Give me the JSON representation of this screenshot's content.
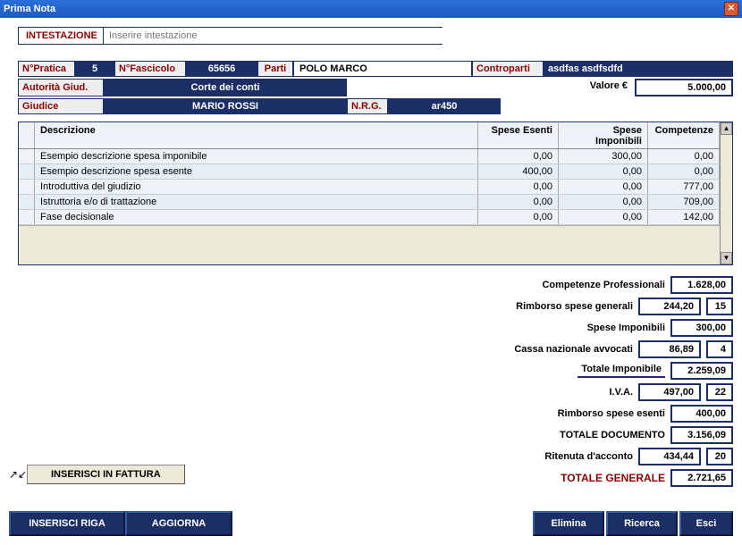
{
  "window": {
    "title": "Prima Nota"
  },
  "intestazione": {
    "label": "INTESTAZIONE",
    "placeholder": "Inserire intestazione"
  },
  "row1": {
    "npratica_label": "N°Pratica",
    "npratica_value": "5",
    "nfascicolo_label": "N°Fascicolo",
    "nfascicolo_value": "65656",
    "parti_label": "Parti",
    "parti_value": "POLO MARCO",
    "controparti_label": "Controparti",
    "controparti_value": "asdfas asdfsdfd"
  },
  "row2": {
    "autorita_label": "Autorità Giud.",
    "autorita_value": "Corte dei conti",
    "valore_label": "Valore €",
    "valore_value": "5.000,00"
  },
  "row3": {
    "giudice_label": "Giudice",
    "giudice_value": "MARIO ROSSI",
    "nrg_label": "N.R.G.",
    "nrg_value": "ar450"
  },
  "grid": {
    "headers": {
      "descrizione": "Descrizione",
      "spese_esenti": "Spese Esenti",
      "spese_imponibili": "Spese Imponibili",
      "competenze": "Competenze"
    },
    "rows": [
      {
        "desc": "Esempio descrizione spesa imponibile",
        "es": "0,00",
        "imp": "300,00",
        "comp": "0,00"
      },
      {
        "desc": "Esempio descrizione spesa esente",
        "es": "400,00",
        "imp": "0,00",
        "comp": "0,00"
      },
      {
        "desc": "Introduttiva del giudizio",
        "es": "0,00",
        "imp": "0,00",
        "comp": "777,00"
      },
      {
        "desc": "Istruttoria e/o di trattazione",
        "es": "0,00",
        "imp": "0,00",
        "comp": "709,00"
      },
      {
        "desc": "Fase decisionale",
        "es": "0,00",
        "imp": "0,00",
        "comp": "142,00"
      }
    ]
  },
  "totals": {
    "competenze_professionali": {
      "label": "Competenze Professionali",
      "value": "1.628,00"
    },
    "rimborso_generali": {
      "label": "Rimborso spese generali",
      "value": "244,20",
      "pct": "15"
    },
    "spese_imponibili": {
      "label": "Spese Imponibili",
      "value": "300,00"
    },
    "cassa_avvocati": {
      "label": "Cassa nazionale avvocati",
      "value": "86,89",
      "pct": "4"
    },
    "totale_imponibile": {
      "label": "Totale Imponibile",
      "value": "2.259,09"
    },
    "iva": {
      "label": "I.V.A.",
      "value": "497,00",
      "pct": "22"
    },
    "rimborso_esenti": {
      "label": "Rimborso spese esenti",
      "value": "400,00"
    },
    "totale_documento": {
      "label": "TOTALE DOCUMENTO",
      "value": "3.156,09"
    },
    "ritenuta": {
      "label": "Ritenuta d'acconto",
      "value": "434,44",
      "pct": "20"
    },
    "totale_generale": {
      "label": "TOTALE GENERALE",
      "value": "2.721,65"
    }
  },
  "buttons": {
    "inserisci_fattura": "INSERISCI IN FATTURA",
    "inserisci_riga": "INSERISCI RIGA",
    "aggiorna": "AGGIORNA",
    "elimina": "Elimina",
    "ricerca": "Ricerca",
    "esci": "Esci"
  }
}
